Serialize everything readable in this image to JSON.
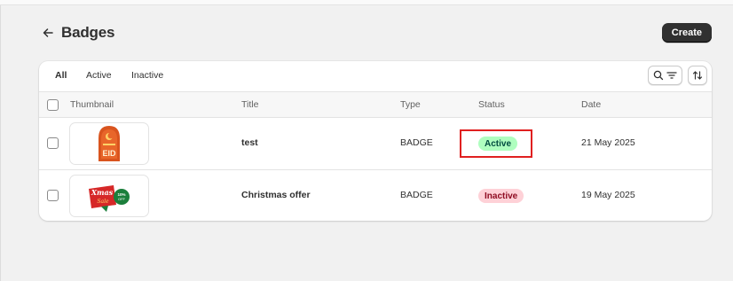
{
  "header": {
    "title": "Badges",
    "create_label": "Create"
  },
  "tabs": [
    "All",
    "Active",
    "Inactive"
  ],
  "table": {
    "columns": [
      "Thumbnail",
      "Title",
      "Type",
      "Status",
      "Date"
    ],
    "rows": [
      {
        "title": "test",
        "type": "BADGE",
        "status": "Active",
        "date": "21 May 2025",
        "thumb_text": "EID"
      },
      {
        "title": "Christmas offer",
        "type": "BADGE",
        "status": "Inactive",
        "date": "19 May 2025",
        "thumb_text": "Xmas"
      }
    ]
  },
  "icons": {
    "back": "arrow-left-icon",
    "search_filter": "search-filter-icon",
    "sort": "sort-icon"
  },
  "colors": {
    "create_bg": "#303030",
    "active_badge_bg": "#affebf",
    "inactive_badge_bg": "#fed1d7",
    "highlight": "#e02020"
  }
}
